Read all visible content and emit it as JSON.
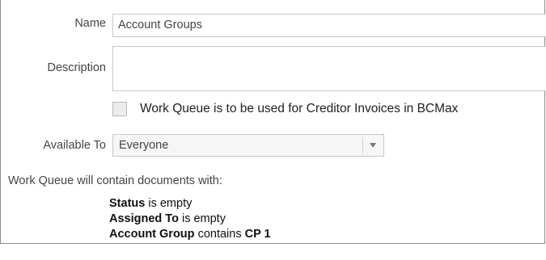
{
  "form": {
    "name_label": "Name",
    "name_value": "Account Groups",
    "description_label": "Description",
    "description_value": "",
    "checkbox_label": "Work Queue is to be used for Creditor Invoices in BCMax",
    "checkbox_checked": false,
    "available_to_label": "Available To",
    "available_to_value": "Everyone"
  },
  "criteria": {
    "heading": "Work Queue will contain documents with:",
    "conditions": [
      {
        "field": "Status",
        "operator": "is empty",
        "value": ""
      },
      {
        "field": "Assigned To",
        "operator": "is empty",
        "value": ""
      },
      {
        "field": "Account Group",
        "operator": "contains",
        "value": "CP 1"
      }
    ]
  },
  "icons": {
    "select_arrow": "chevron-down-icon"
  }
}
